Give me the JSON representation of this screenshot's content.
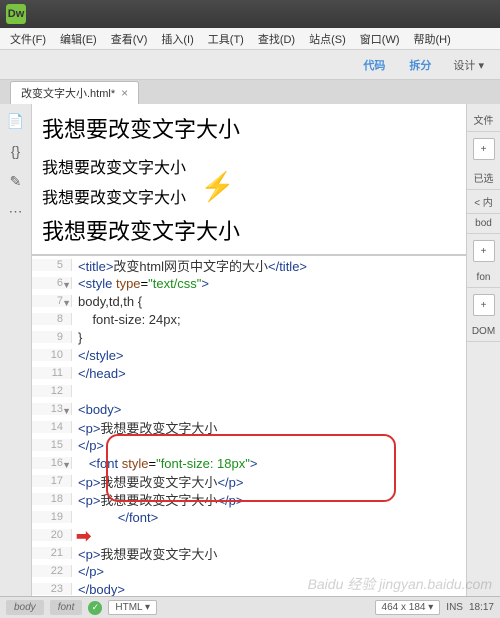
{
  "app": {
    "logo": "Dw"
  },
  "menu": {
    "file": "文件(F)",
    "edit": "编辑(E)",
    "view": "查看(V)",
    "insert": "插入(I)",
    "tools": "工具(T)",
    "find": "查找(D)",
    "site": "站点(S)",
    "window": "窗口(W)",
    "help": "帮助(H)"
  },
  "docbar": {
    "code": "代码",
    "split": "拆分",
    "design": "设计",
    "dd_arrow": "▾"
  },
  "tab": {
    "name": "改变文字大小.html*",
    "close": "×"
  },
  "tools_left": {
    "doc": "📄",
    "code": "{}",
    "wand": "✎",
    "dots": "⋯"
  },
  "preview": {
    "h1": "我想要改变文字大小",
    "p1": "我想要改变文字大小",
    "p2": "我想要改变文字大小",
    "p3": "我想要改变文字大小"
  },
  "code_lines": [
    {
      "n": "5",
      "html": "<span class='tag'>&lt;title&gt;</span><span class='text'>改变html网页中文字的大小</span><span class='tag'>&lt;/title&gt;</span>"
    },
    {
      "n": "6",
      "fold": "▼",
      "html": "<span class='tag'>&lt;style</span> <span class='attr'>type</span>=<span class='val'>\"text/css\"</span><span class='tag'>&gt;</span>"
    },
    {
      "n": "7",
      "fold": "▼",
      "html": "<span class='text'>body,td,th {</span>"
    },
    {
      "n": "8",
      "html": "<span class='text'>    font-size: 24px;</span>"
    },
    {
      "n": "9",
      "html": "<span class='text'>}</span>"
    },
    {
      "n": "10",
      "html": "<span class='tag'>&lt;/style&gt;</span>"
    },
    {
      "n": "11",
      "html": "<span class='tag'>&lt;/head&gt;</span>"
    },
    {
      "n": "12",
      "html": ""
    },
    {
      "n": "13",
      "fold": "▼",
      "html": "<span class='tag'>&lt;body&gt;</span>"
    },
    {
      "n": "14",
      "html": "<span class='tag'>&lt;p&gt;</span><span class='text'>我想要改变文字大小</span>"
    },
    {
      "n": "15",
      "html": "<span class='tag'>&lt;/p&gt;</span>"
    },
    {
      "n": "16",
      "fold": "▼",
      "html": "   <span class='tag'>&lt;font</span> <span class='attr'>style</span>=<span class='val'>\"font-size: 18px\"</span><span class='tag'>&gt;</span>"
    },
    {
      "n": "17",
      "html": "<span class='tag'>&lt;p&gt;</span><span class='text'>我想要改变文字大小</span><span class='tag'>&lt;/p&gt;</span>"
    },
    {
      "n": "18",
      "html": "<span class='tag'>&lt;p&gt;</span><span class='text'>我想要改变文字大小</span><span class='tag'>&lt;/p&gt;</span>"
    },
    {
      "n": "19",
      "html": "           <span class='tag'>&lt;/font&gt;</span>"
    },
    {
      "n": "20",
      "html": ""
    },
    {
      "n": "21",
      "html": "<span class='tag'>&lt;p&gt;</span><span class='text'>我想要改变文字大小</span>"
    },
    {
      "n": "22",
      "html": "<span class='tag'>&lt;/p&gt;</span>"
    },
    {
      "n": "23",
      "html": "<span class='tag'>&lt;/body&gt;</span>"
    }
  ],
  "right": {
    "files": "文件",
    "plus": "+",
    "sel_lbl": "已选",
    "row1": "< 内",
    "row2": "bod",
    "font_lbl": "fon",
    "dom_lbl": "DOM"
  },
  "status": {
    "crumb1": "body",
    "crumb2": "font",
    "ok": "✓",
    "lang": "HTML",
    "dim": "464 x 184",
    "ins": "INS",
    "line": "18:17"
  },
  "watermark": "Baidu 经验 jingyan.baidu.com",
  "lightning": "⚡"
}
